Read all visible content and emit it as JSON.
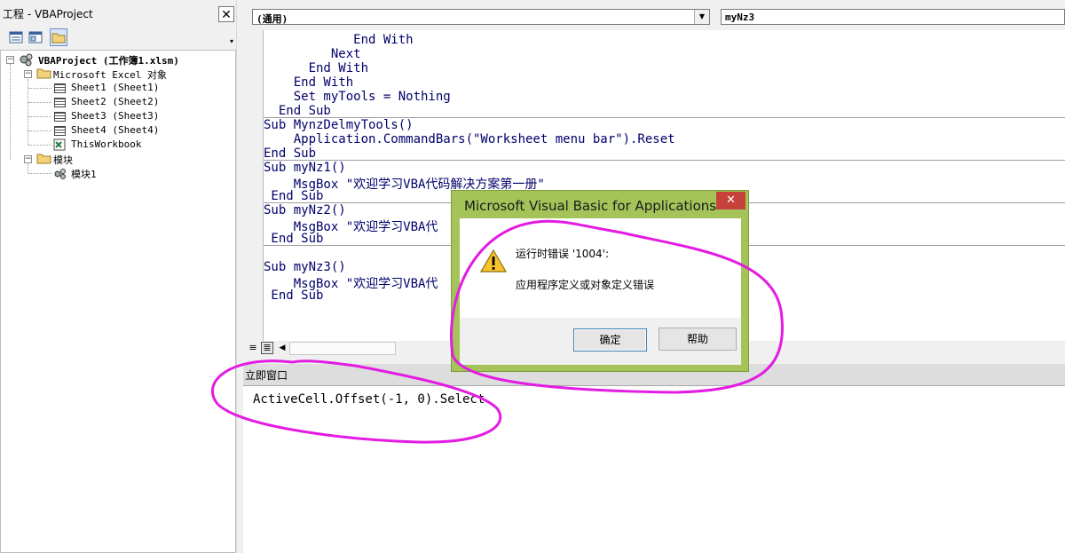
{
  "project": {
    "title": "工程 - VBAProject",
    "close": "✕",
    "root": "VBAProject (工作簿1.xlsm)",
    "group_excel": "Microsoft Excel 对象",
    "items": [
      "Sheet1 (Sheet1)",
      "Sheet2 (Sheet2)",
      "Sheet3 (Sheet3)",
      "Sheet4 (Sheet4)",
      "ThisWorkbook"
    ],
    "group_modules": "模块",
    "module1": "模块1"
  },
  "code": {
    "object_select": "(通用)",
    "proc_select": "myNz3",
    "lines": [
      "            End With",
      "         Next",
      "      End With",
      "    End With",
      "    Set myTools = Nothing",
      "  End Sub",
      "Sub MynzDelmyTools()",
      "    Application.CommandBars(\"Worksheet menu bar\").Reset",
      "End Sub",
      "Sub myNz1()",
      "    MsgBox \"欢迎学习VBA代码解决方案第一册\"",
      " End Sub",
      "Sub myNz2()",
      "    MsgBox \"欢迎学习VBA代",
      " End Sub",
      "",
      "Sub myNz3()",
      "    MsgBox \"欢迎学习VBA代",
      " End Sub"
    ]
  },
  "immediate": {
    "title": "立即窗口",
    "text": "ActiveCell.Offset(-1, 0).Select"
  },
  "dialog": {
    "title": "Microsoft Visual Basic for Applications",
    "close": "✕",
    "error_title": "运行时错误 '1004':",
    "error_message": "应用程序定义或对象定义错误",
    "ok_label": "确定",
    "help_label": "帮助"
  },
  "colors": {
    "code_text": "#00006a",
    "dialog_frame": "#a4c45a",
    "annotation": "#e31be3"
  }
}
